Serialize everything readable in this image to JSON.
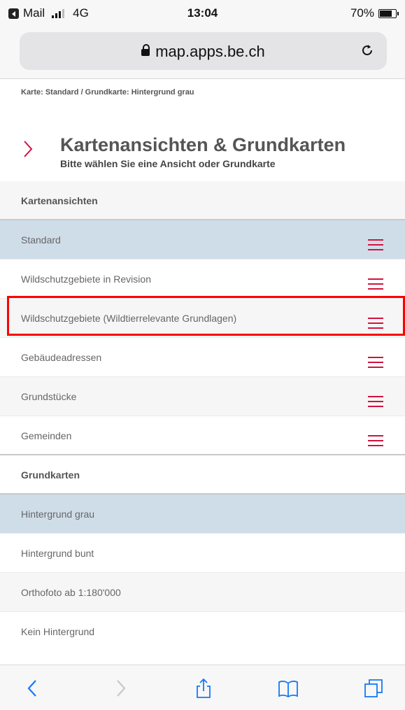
{
  "status_bar": {
    "carrier": "Mail",
    "network": "4G",
    "time": "13:04",
    "battery": "70%"
  },
  "browser": {
    "url": "map.apps.be.ch"
  },
  "breadcrumb": "Karte: Standard / Grundkarte: Hintergrund grau",
  "header": {
    "title": "Kartenansichten & Grundkarten",
    "subtitle": "Bitte wählen Sie eine Ansicht oder Grundkarte"
  },
  "groups": {
    "views": "Kartenansichten",
    "basemaps": "Grundkarten"
  },
  "views": [
    {
      "label": "Standard"
    },
    {
      "label": "Wildschutzgebiete in Revision"
    },
    {
      "label": "Wildschutzgebiete (Wildtierrelevante Grundlagen)"
    },
    {
      "label": "Gebäudeadressen"
    },
    {
      "label": "Grundstücke"
    },
    {
      "label": "Gemeinden"
    }
  ],
  "basemaps": [
    {
      "label": "Hintergrund grau"
    },
    {
      "label": "Hintergrund bunt"
    },
    {
      "label": "Orthofoto ab 1:180'000"
    },
    {
      "label": "Kein Hintergrund"
    }
  ],
  "colors": {
    "accent": "#d3123f",
    "selected": "#cfdde9",
    "highlight": "#ff0000"
  }
}
